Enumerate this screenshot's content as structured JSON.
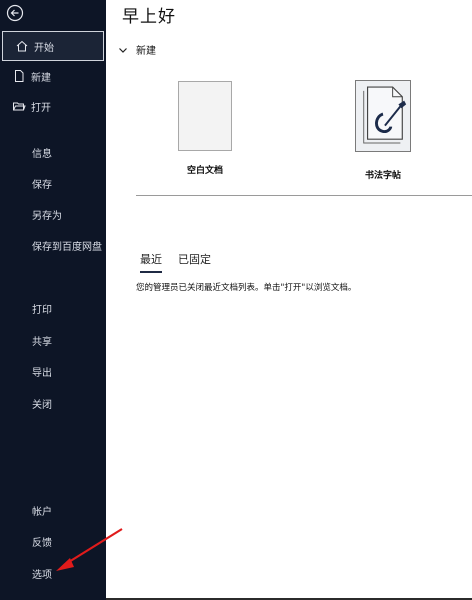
{
  "sidebar": {
    "items": [
      {
        "label": "开始",
        "icon": "home-icon",
        "selected": true
      },
      {
        "label": "新建",
        "icon": "new-document-icon"
      },
      {
        "label": "打开",
        "icon": "open-folder-icon"
      }
    ],
    "subitems": [
      "信息",
      "保存",
      "另存为",
      "保存到百度网盘",
      "打印",
      "共享",
      "导出",
      "关闭"
    ],
    "footer": [
      "帐户",
      "反馈",
      "选项"
    ]
  },
  "main": {
    "greeting": "早上好",
    "new_section": {
      "title": "新建",
      "templates": [
        {
          "label": "空白文档"
        },
        {
          "label": "书法字帖"
        }
      ]
    },
    "tabs": [
      {
        "label": "最近",
        "active": true
      },
      {
        "label": "已固定"
      }
    ],
    "notice": "您的管理员已关闭最近文档列表。单击\"打开\"以浏览文档。"
  },
  "colors": {
    "sidebar_bg": "#0d1526",
    "annotation_arrow": "#e01b1b"
  }
}
